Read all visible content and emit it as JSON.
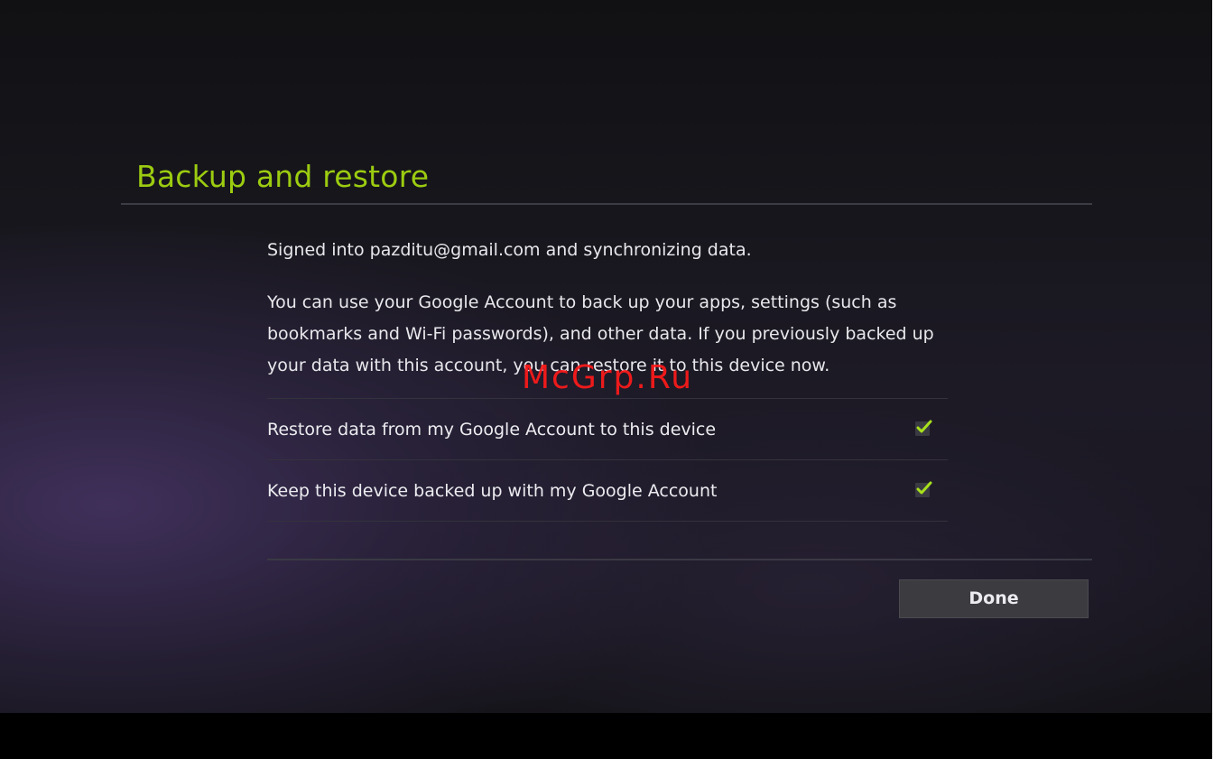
{
  "dialog": {
    "title": "Backup and restore",
    "signed_in_text": "Signed into pazditu@gmail.com and synchronizing data.",
    "description": "You can use your Google Account to back up your apps, settings (such as bookmarks and Wi-Fi passwords), and other data. If you previously backed up your data with this account, you can restore it to this device now.",
    "options": [
      {
        "label": "Restore data from my Google Account to this device",
        "checked": true
      },
      {
        "label": "Keep this device backed up with my Google Account",
        "checked": true
      }
    ],
    "done_label": "Done"
  },
  "watermark": "McGrp.Ru",
  "colors": {
    "accent": "#9ccc10",
    "watermark": "#ff1a1a"
  }
}
